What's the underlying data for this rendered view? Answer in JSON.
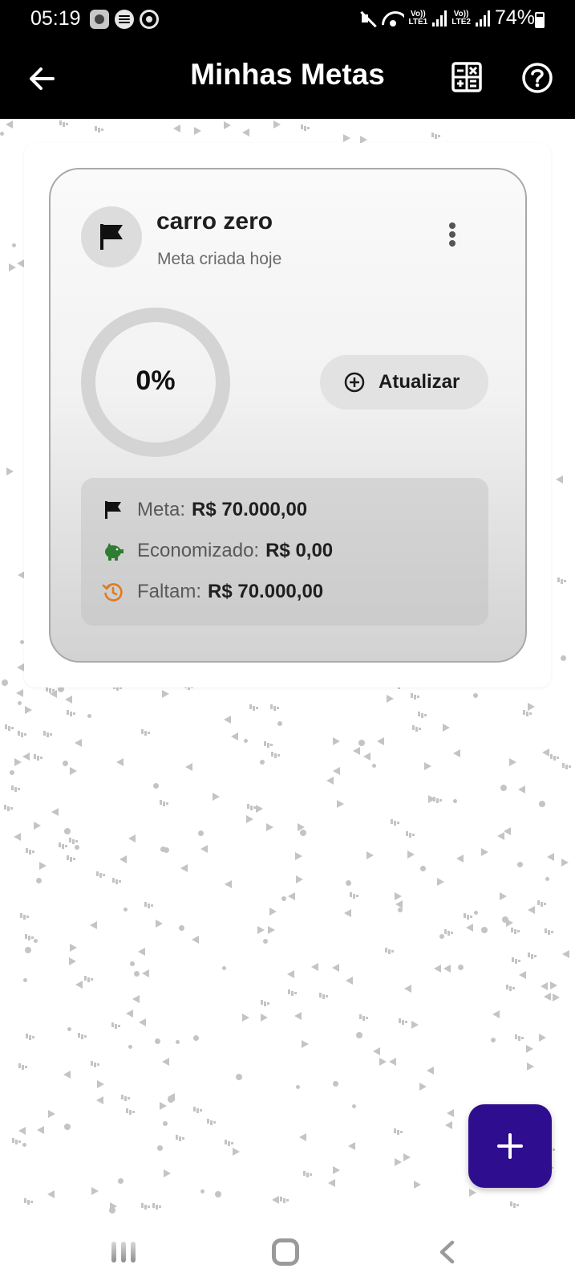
{
  "status_bar": {
    "time": "05:19",
    "battery": "74%",
    "sim1": "Vo))\nLTE1",
    "sim2": "Vo))\nLTE2",
    "notification_icons": [
      "camera-app-icon",
      "spotify-icon",
      "notification-app-icon"
    ]
  },
  "app_bar": {
    "title": "Minhas Metas",
    "back_icon": "arrow-left-icon",
    "calculator_icon": "calculator-icon",
    "help_icon": "help-circle-icon"
  },
  "goal_card": {
    "name": "carro zero",
    "subtitle": "Meta criada hoje",
    "progress_text": "0%",
    "progress_value": 0,
    "update_button": "Atualizar",
    "rows": [
      {
        "label": "Meta:",
        "value": "R$ 70.000,00",
        "icon": "flag-icon",
        "color": "#111111"
      },
      {
        "label": "Economizado:",
        "value": "R$ 0,00",
        "icon": "piggy-bank-icon",
        "color": "#2e7d32"
      },
      {
        "label": "Faltam:",
        "value": "R$ 70.000,00",
        "icon": "history-icon",
        "color": "#e07b1f"
      }
    ]
  },
  "fab": {
    "icon": "plus-icon",
    "color": "#2e0e8e"
  },
  "nav_bar": {
    "recents": "recents-icon",
    "home": "home-icon",
    "back": "back-icon"
  }
}
